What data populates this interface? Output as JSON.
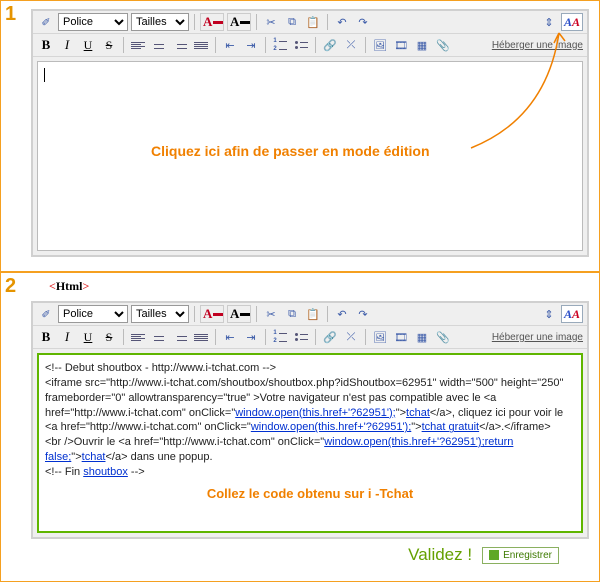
{
  "steps": {
    "one": "1",
    "two": "2"
  },
  "html_badge": "Html",
  "toolbar": {
    "font_label": "Police",
    "size_label": "Tailles",
    "host_image": "Héberger une image"
  },
  "callouts": {
    "edit_mode": "Cliquez ici afin de passer en mode édition",
    "paste_code": "Collez le code obtenu sur i -Tchat",
    "validate": "Validez !"
  },
  "buttons": {
    "save": "Enregistrer"
  },
  "code": {
    "l1": "<!-- Debut shoutbox - http://www.i-tchat.com -->",
    "l2a": "<iframe src=\"http://www.i-tchat.com/shoutbox/shoutbox.php?idShoutbox=62951\" width=\"500\" height=\"250\" frameborder=\"0\" allowtransparency=\"true\" >Votre navigateur n'est pas compatible avec le <a href=\"http://www.i-tchat.com\" onClick=\"",
    "l2_js1": "window.open(this.href+'?62951');",
    "l2b": "\">",
    "l2_link1": "tchat",
    "l2c": "</a>, cliquez ici pour voir le <a href=\"http://www.i-tchat.com\" onClick=\"",
    "l2_js2": "window.open(this.href+'?62951');",
    "l2d": "\">",
    "l2_link2": "tchat gratuit",
    "l2e": "</a>.</iframe>",
    "l3a": "<br />Ouvrir le <a href=\"http://www.i-tchat.com\" onClick=\"",
    "l3_js": "window.open(this.href+'?62951');return false;",
    "l3b": "\">",
    "l3_link": "tchat",
    "l3c": "</a> dans une popup.",
    "l4a": "<!-- Fin ",
    "l4_link": "shoutbox",
    "l4b": " -->"
  }
}
